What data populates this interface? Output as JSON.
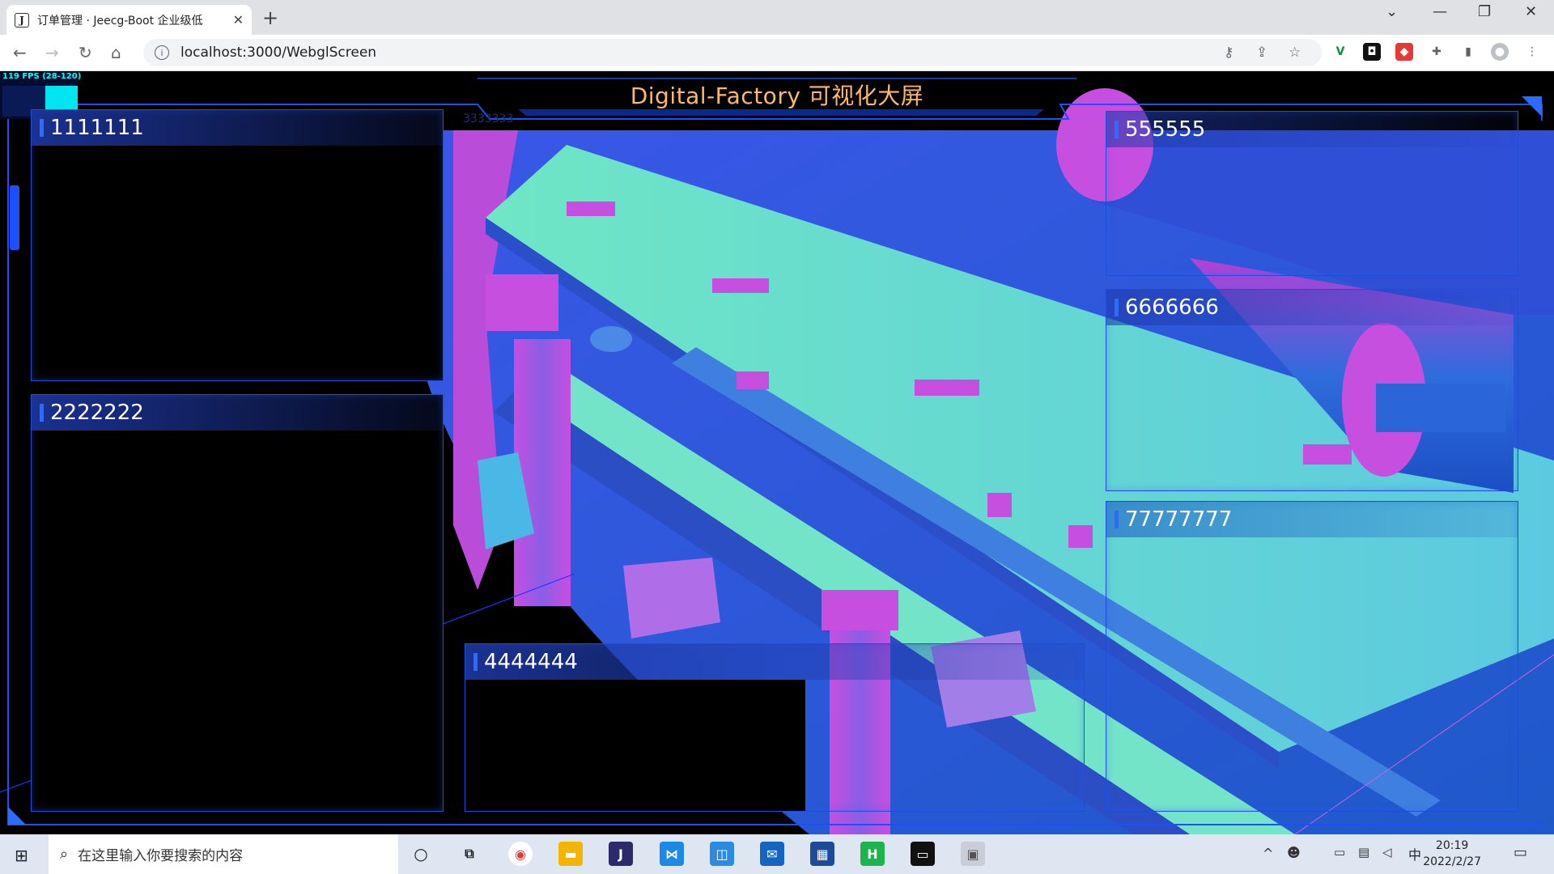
{
  "browser": {
    "tab_title": "订单管理 · Jeecg-Boot 企业级低",
    "tab_favicon": "J",
    "url": "localhost:3000/WebglScreen"
  },
  "screen": {
    "title": "Digital-Factory 可视化大屏",
    "fps": "119 FPS (28-120)",
    "overlay_text": "3333333",
    "panels": {
      "p1": "1111111",
      "p2": "2222222",
      "p4": "4444444",
      "p5": "555555",
      "p6": "6666666",
      "p7": "77777777"
    }
  },
  "taskbar": {
    "search_placeholder": "在这里输入你要搜索的内容",
    "ime": "中",
    "time": "20:19",
    "date": "2022/2/27"
  },
  "colors": {
    "accent": "#1d4ed8",
    "title": "#ffb86b",
    "model_cyan": "#62e0cc",
    "model_blue": "#2b5fd9",
    "model_magenta": "#c64fe0"
  }
}
